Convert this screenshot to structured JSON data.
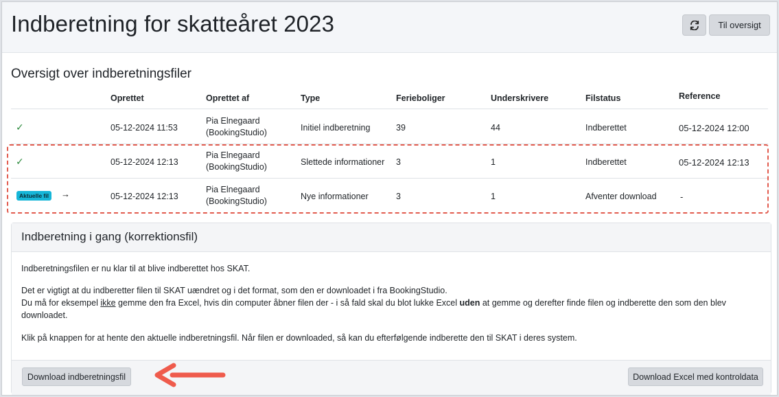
{
  "header": {
    "title": "Indberetning for skatteåret 2023",
    "refresh_icon": "refresh-icon",
    "overview_label": "Til oversigt"
  },
  "files": {
    "title": "Oversigt over indberetningsfiler",
    "columns": [
      "Oprettet",
      "Oprettet af",
      "Type",
      "Ferieboliger",
      "Underskrivere",
      "Filstatus",
      "Reference"
    ],
    "rows": [
      {
        "status_icon": "check-icon",
        "created": "05-12-2024 11:53",
        "created_by_1": "Pia Elnegaard",
        "created_by_2": "(BookingStudio)",
        "type": "Initiel indberetning",
        "holiday_homes": "39",
        "signers": "44",
        "file_status": "Indberettet",
        "reference": "05-12-2024 12:00"
      },
      {
        "status_icon": "check-icon",
        "created": "05-12-2024 12:13",
        "created_by_1": "Pia Elnegaard",
        "created_by_2": "(BookingStudio)",
        "type": "Slettede informationer",
        "holiday_homes": "3",
        "signers": "1",
        "file_status": "Indberettet",
        "reference": "05-12-2024 12:13"
      },
      {
        "badge": "Aktuelle fil",
        "arrow": "→",
        "created": "05-12-2024 12:13",
        "created_by_1": "Pia Elnegaard",
        "created_by_2": "(BookingStudio)",
        "type": "Nye informationer",
        "holiday_homes": "3",
        "signers": "1",
        "file_status": "Afventer download",
        "reference": "-"
      }
    ],
    "highlight_color": "#e25b4e",
    "badge_color": "#16b6d8",
    "check_color": "#2e8b3e"
  },
  "correction": {
    "title": "Indberetning i gang (korrektionsfil)",
    "p1": "Indberetningsfilen er nu klar til at blive indberettet hos SKAT.",
    "p2_line1": "Det er vigtigt at du indberetter filen til SKAT uændret og i det format, som den er downloadet i fra BookingStudio.",
    "p2_line2_a": "Du må for eksempel ",
    "p2_line2_u": "ikke",
    "p2_line2_b": " gemme den fra Excel, hvis din computer åbner filen der - i så fald skal du blot lukke Excel ",
    "p2_line2_bold": "uden",
    "p2_line2_c": " at gemme og derefter finde filen og indberette den som den blev",
    "p2_line3": "downloadet.",
    "p3": "Klik på knappen for at hente den aktuelle indberetningsfil. Når filen er downloaded, så kan du efterfølgende indberette den til SKAT i deres system.",
    "download_label": "Download indberetningsfil",
    "excel_label": "Download Excel med kontroldata",
    "pointer_color": "#ef5b4c"
  }
}
